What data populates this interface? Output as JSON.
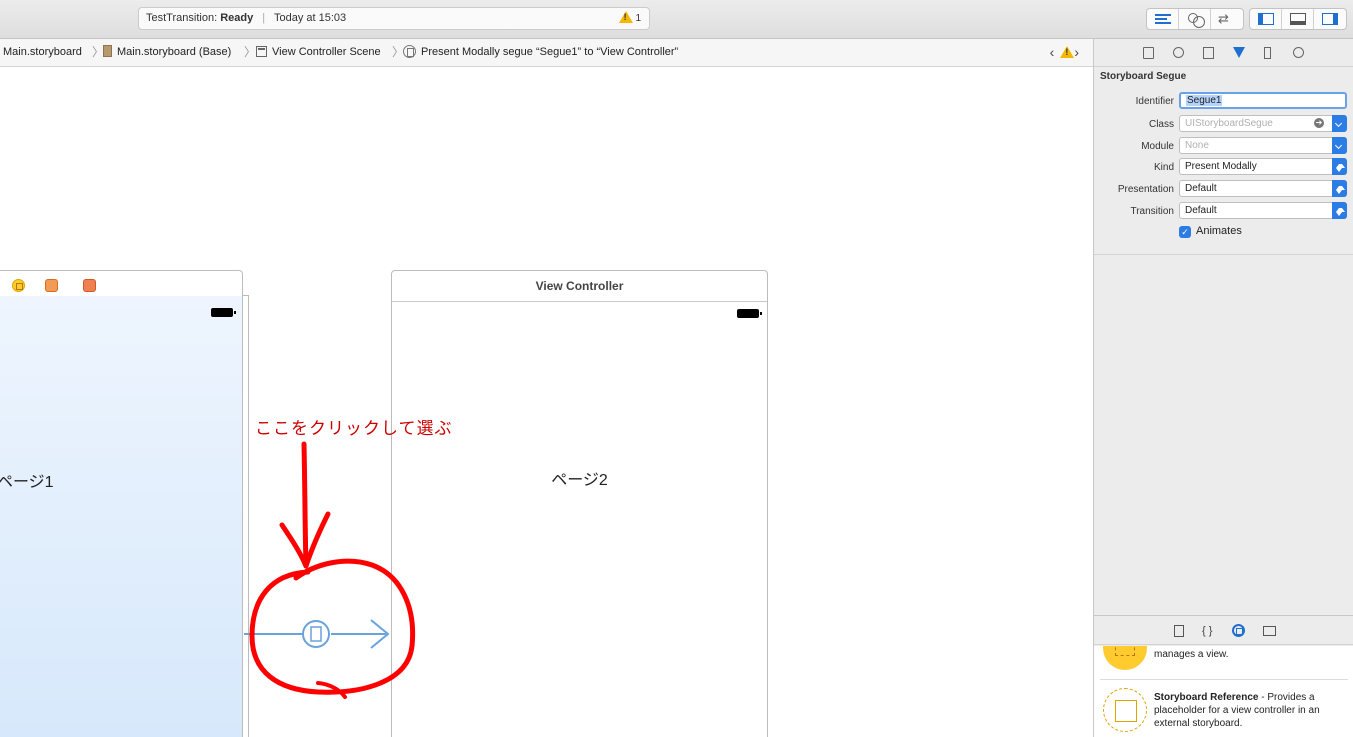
{
  "toolbar": {
    "project": "TestTransition:",
    "status": "Ready",
    "time": "Today at 15:03",
    "warning_count": "1",
    "editor_buttons": [
      "standard-editor-icon",
      "assistant-editor-icon",
      "version-editor-icon"
    ],
    "panel_buttons": [
      "navigator-panel-icon",
      "debug-panel-icon",
      "utilities-panel-icon"
    ]
  },
  "breadcrumb": {
    "items": [
      "Main.storyboard",
      "Main.storyboard (Base)",
      "View Controller Scene",
      "Present Modally segue “Segue1” to “View Controller”"
    ]
  },
  "canvas": {
    "scene1": {
      "label": "ページ1"
    },
    "scene2": {
      "title": "View Controller",
      "label": "ページ2"
    },
    "annotation": "ここをクリックして選ぶ"
  },
  "inspector": {
    "section_title": "Storyboard Segue",
    "identifier": {
      "label": "Identifier",
      "value": "Segue1"
    },
    "class": {
      "label": "Class",
      "placeholder": "UIStoryboardSegue"
    },
    "module": {
      "label": "Module",
      "placeholder": "None"
    },
    "kind": {
      "label": "Kind",
      "value": "Present Modally"
    },
    "presentation": {
      "label": "Presentation",
      "value": "Default"
    },
    "transition": {
      "label": "Transition",
      "value": "Default"
    },
    "animates": {
      "label": "Animates",
      "checked": true
    }
  },
  "library": {
    "items": [
      {
        "title": "",
        "description": "manages a view."
      },
      {
        "title": "Storyboard Reference",
        "description": " - Provides a placeholder for a view controller in an external storyboard."
      }
    ]
  },
  "colors": {
    "accent": "#2c7ce6",
    "annotation": "#ff0000",
    "segue": "#6aa2dc"
  }
}
